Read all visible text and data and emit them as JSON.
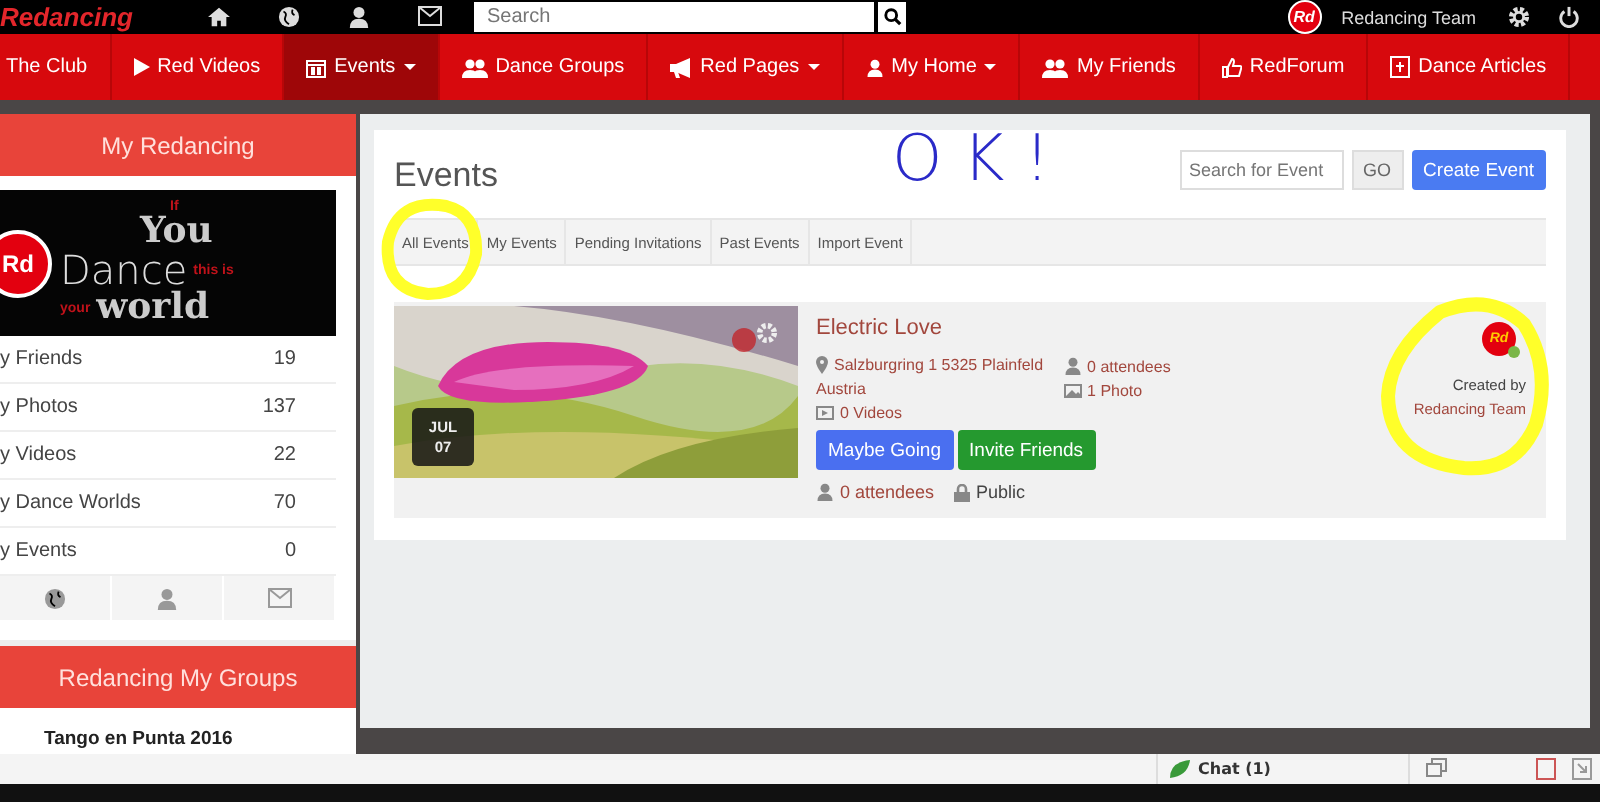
{
  "topbar": {
    "logo": "Redancing",
    "search": {
      "placeholder": "Search"
    },
    "avatar": "Rd",
    "user": "Redancing Team"
  },
  "nav": [
    {
      "label": "The Club",
      "selected": false,
      "dropdown": false
    },
    {
      "label": "Red Videos",
      "selected": false,
      "dropdown": false
    },
    {
      "label": "Events",
      "selected": true,
      "dropdown": true
    },
    {
      "label": "Dance Groups",
      "selected": false,
      "dropdown": false
    },
    {
      "label": "Red Pages",
      "selected": false,
      "dropdown": true
    },
    {
      "label": "My Home",
      "selected": false,
      "dropdown": true
    },
    {
      "label": "My Friends",
      "selected": false,
      "dropdown": false
    },
    {
      "label": "RedForum",
      "selected": false,
      "dropdown": false
    },
    {
      "label": "Dance Articles",
      "selected": false,
      "dropdown": false
    }
  ],
  "sidebar": {
    "title": "My Redancing",
    "banner": {
      "badge": "Rd",
      "words": [
        "If",
        "You",
        "Dance",
        "this is",
        "your",
        "world"
      ]
    },
    "stats": [
      {
        "label": "y Friends",
        "count": "19"
      },
      {
        "label": "y Photos",
        "count": "137"
      },
      {
        "label": "y Videos",
        "count": "22"
      },
      {
        "label": "y Dance Worlds",
        "count": "70"
      },
      {
        "label": "y Events",
        "count": "0"
      }
    ],
    "groups_title": "Redancing My Groups",
    "groups": [
      "Tango en Punta 2016"
    ]
  },
  "events": {
    "title": "Events",
    "search": {
      "placeholder": "Search for Event"
    },
    "go": "GO",
    "create": "Create Event",
    "tabs": [
      {
        "label": "All Events"
      },
      {
        "label": "My Events"
      },
      {
        "label": "Pending Invitations"
      },
      {
        "label": "Past Events"
      },
      {
        "label": "Import Event"
      }
    ],
    "items": [
      {
        "title": "Electric Love",
        "month": "JUL",
        "day": "07",
        "address": "Salzburgring 1 5325 Plainfeld",
        "country": "Austria",
        "videos": "0 Videos",
        "attendees": "0 attendees",
        "photos": "1 Photo",
        "buttons": [
          "Maybe Going",
          "Invite Friends"
        ],
        "footer_attendees": "0 attendees",
        "privacy": "Public",
        "created_by": "Created by",
        "creator": "Redancing Team",
        "creator_avatar": "Rd",
        "creator_online": true
      }
    ]
  },
  "annotation": {
    "text": "OK!"
  },
  "chat": {
    "label": "Chat (1)"
  }
}
